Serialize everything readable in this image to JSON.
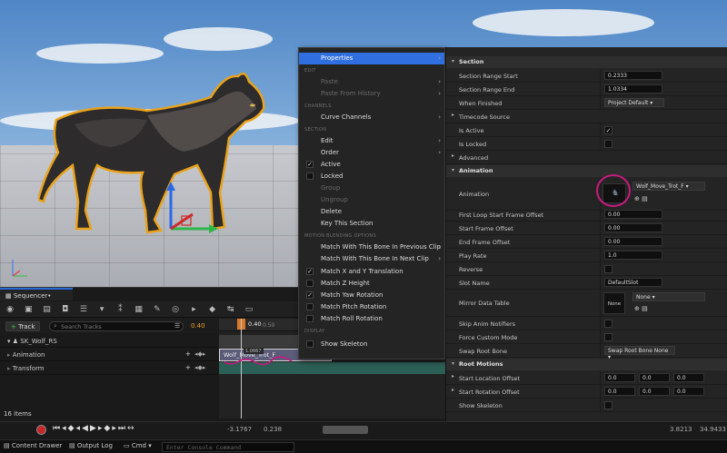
{
  "menu": {
    "properties": "Properties",
    "edit_header": "EDIT",
    "paste": "Paste",
    "paste_history": "Paste From History",
    "channels_header": "CHANNELS",
    "curve_channels": "Curve Channels",
    "section_header": "SECTION",
    "edit": "Edit",
    "order": "Order",
    "active": "Active",
    "locked": "Locked",
    "group": "Group",
    "ungroup": "Ungroup",
    "delete": "Delete",
    "key_section": "Key This Section",
    "motion_header": "MOTION BLENDING OPTIONS",
    "match_prev": "Match With This Bone In Previous Clip",
    "match_next": "Match With This Bone In Next Clip",
    "match_xy": "Match X and Y Translation",
    "match_z": "Match Z Height",
    "match_yaw": "Match Yaw Rotation",
    "match_pitch": "Match Pitch Rotation",
    "match_roll": "Match Roll Rotation",
    "display_header": "DISPLAY",
    "show_skeleton": "Show Skeleton"
  },
  "details": {
    "section_cat": "Section",
    "range_start_label": "Section Range Start",
    "range_start": "0.2333",
    "range_end_label": "Section Range End",
    "range_end": "1.0334",
    "when_finished_label": "When Finished",
    "when_finished": "Project Default",
    "timecode": "Timecode Source",
    "is_active": "Is Active",
    "is_locked": "Is Locked",
    "advanced": "Advanced",
    "animation_cat": "Animation",
    "animation_label": "Animation",
    "animation_asset": "Wolf_Move_Trot_F",
    "first_loop_label": "First Loop Start Frame Offset",
    "first_loop": "0.00",
    "start_offset_label": "Start Frame Offset",
    "start_offset": "0.00",
    "end_offset_label": "End Frame Offset",
    "end_offset": "0.00",
    "play_rate_label": "Play Rate",
    "play_rate": "1.0",
    "reverse": "Reverse",
    "slot_name_label": "Slot Name",
    "slot_name": "DefaultSlot",
    "mirror_label": "Mirror Data Table",
    "mirror_thumb": "None",
    "mirror_value": "None",
    "skip_notifies": "Skip Anim Notifiers",
    "force_custom": "Force Custom Mode",
    "swap_root_label": "Swap Root Bone",
    "swap_root": "Swap Root Bone None",
    "root_motions_cat": "Root Motions",
    "start_loc_label": "Start Location Offset",
    "start_loc": [
      "0.0",
      "0.0",
      "0.0"
    ],
    "start_rot_label": "Start Rotation Offset",
    "start_rot": [
      "0.0",
      "0.0",
      "0.0"
    ],
    "show_skeleton": "Show Skeleton"
  },
  "sequencer": {
    "tab": "Sequencer•",
    "track_button": "Track",
    "search_placeholder": "Search Tracks",
    "time": "0.40",
    "playhead_time": "0.40",
    "ruler_mark": "0.50",
    "object": "SK_Wolf_RS",
    "track_animation": "Animation",
    "track_transform": "Transform",
    "section_label": "Wolf_Move_Trot_F",
    "section_time": "1.0667",
    "items": "16 items",
    "range_start": "-3.1767",
    "range_in": "0.238",
    "range_end_a": "3.8213",
    "range_end_b": "34.9433"
  },
  "status": {
    "content_drawer": "Content Drawer",
    "output_log": "Output Log",
    "cmd": "Cmd",
    "console_placeholder": "Enter Console Command"
  },
  "colors": {
    "accent": "#2f6fdf",
    "highlight": "#e9a21a",
    "annotation": "#c8197e"
  }
}
